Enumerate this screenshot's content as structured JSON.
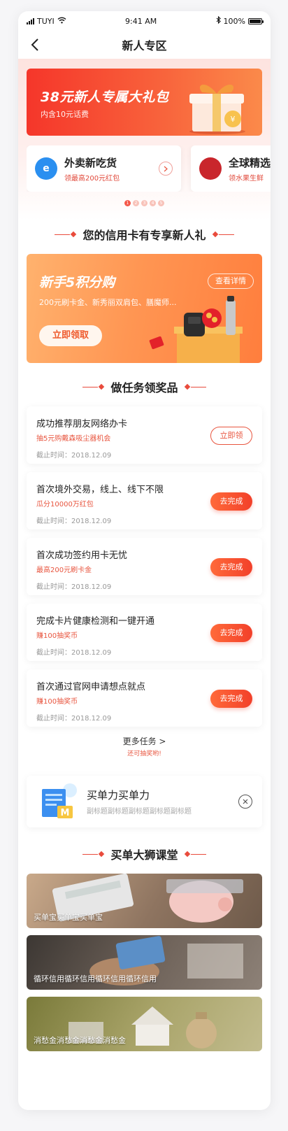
{
  "status_bar": {
    "carrier": "TUYI",
    "time": "9:41 AM",
    "battery": "100%"
  },
  "nav": {
    "title": "新人专区"
  },
  "gift_banner": {
    "title": "38元新人专属大礼包",
    "subtitle": "内含10元话费"
  },
  "promos": [
    {
      "title": "外卖新吃货",
      "desc": "领最高200元红包",
      "logo": "e",
      "logo_color": "#2a8ff0"
    },
    {
      "title": "全球精选",
      "desc": "领水果生鲜",
      "logo": "",
      "logo_color": "#c9262c"
    }
  ],
  "carousel_dots": [
    "1",
    "2",
    "3",
    "4",
    "5"
  ],
  "section_credit": "您的信用卡有专享新人礼",
  "credit_card": {
    "title": "新手5积分购",
    "subtitle": "200元刷卡金、新秀丽双肩包、膳魔师...",
    "detail_label": "查看详情",
    "cta_label": "立即领取"
  },
  "section_tasks": "做任务领奖品",
  "tasks": [
    {
      "title": "成功推荐朋友网络办卡",
      "reward": "抽5元购戴森吸尘器机会",
      "deadline": "截止时间：2018.12.09",
      "button": "立即领",
      "style": "outline"
    },
    {
      "title": "首次境外交易，线上、线下不限",
      "reward": "瓜分10000万红包",
      "deadline": "截止时间：2018.12.09",
      "button": "去完成",
      "style": "solid"
    },
    {
      "title": "首次成功签约用卡无忧",
      "reward": "最高200元刷卡金",
      "deadline": "截止时间：2018.12.09",
      "button": "去完成",
      "style": "solid"
    },
    {
      "title": "完成卡片健康检测和一键开通",
      "reward": "赚100抽奖币",
      "deadline": "截止时间：2018.12.09",
      "button": "去完成",
      "style": "solid"
    },
    {
      "title": "首次通过官网申请想点就点",
      "reward": "赚100抽奖币",
      "deadline": "截止时间：2018.12.09",
      "button": "去完成",
      "style": "solid"
    }
  ],
  "more_tasks": {
    "label": "更多任务 >",
    "hint": "还可抽奖哟!"
  },
  "ad_card": {
    "title": "买单力买单力",
    "subtitle": "副标题副标题副标题副标题副标题"
  },
  "section_course": "买单大狮课堂",
  "courses": [
    {
      "label": "买单宝买单宝买单宝"
    },
    {
      "label": "循环信用循环信用循环信用循环信用"
    },
    {
      "label": "消愁金消愁金消愁金消愁金"
    }
  ],
  "colors": {
    "accent": "#f2402a",
    "reward_text": "#e8553f"
  }
}
